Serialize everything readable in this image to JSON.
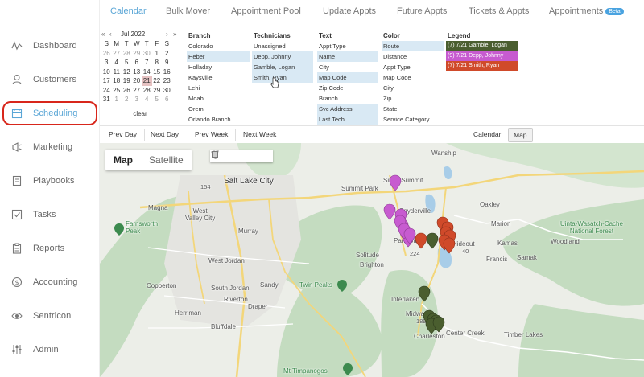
{
  "sidebar": {
    "items": [
      {
        "label": "Dashboard",
        "icon": "activity-icon"
      },
      {
        "label": "Customers",
        "icon": "user-icon"
      },
      {
        "label": "Scheduling",
        "icon": "calendar-icon"
      },
      {
        "label": "Marketing",
        "icon": "megaphone-icon"
      },
      {
        "label": "Playbooks",
        "icon": "book-icon"
      },
      {
        "label": "Tasks",
        "icon": "checkbox-icon"
      },
      {
        "label": "Reports",
        "icon": "clipboard-icon"
      },
      {
        "label": "Accounting",
        "icon": "dollar-icon"
      },
      {
        "label": "Sentricon",
        "icon": "eye-icon"
      },
      {
        "label": "Admin",
        "icon": "sliders-icon"
      }
    ],
    "active": "Scheduling",
    "highlight_color": "#d8261b",
    "accent": "#5aa6d6"
  },
  "topnav": {
    "tabs": [
      "Calendar",
      "Bulk Mover",
      "Appointment Pool",
      "Update Appts",
      "Future Appts",
      "Tickets & Appts",
      "Appointments"
    ],
    "active": "Calendar",
    "beta_badge": "Beta"
  },
  "calendar": {
    "prev": "«",
    "prev_month": "‹",
    "next_month": "›",
    "next": "»",
    "title": "Jul 2022",
    "weekdays": [
      "S",
      "M",
      "T",
      "W",
      "T",
      "F",
      "S"
    ],
    "weeks": [
      [
        "26",
        "27",
        "28",
        "29",
        "30",
        "1",
        "2"
      ],
      [
        "3",
        "4",
        "5",
        "6",
        "7",
        "8",
        "9"
      ],
      [
        "10",
        "11",
        "12",
        "13",
        "14",
        "15",
        "16"
      ],
      [
        "17",
        "18",
        "19",
        "20",
        "21",
        "22",
        "23"
      ],
      [
        "24",
        "25",
        "26",
        "27",
        "28",
        "29",
        "30"
      ],
      [
        "31",
        "1",
        "2",
        "3",
        "4",
        "5",
        "6"
      ]
    ],
    "selected_day": "21",
    "clear": "clear"
  },
  "filters": {
    "branch": {
      "header": "Branch",
      "items": [
        "Colorado",
        "Heber",
        "Holladay",
        "Kaysville",
        "Lehi",
        "Moab",
        "Orem",
        "Orlando Branch"
      ],
      "selected": [
        "Heber"
      ]
    },
    "technicians": {
      "header": "Technicians",
      "items": [
        "Unassigned",
        "Depp, Johnny",
        "Gamble, Logan",
        "Smith, Ryan"
      ],
      "selected": [
        "Depp, Johnny",
        "Gamble, Logan",
        "Smith, Ryan"
      ]
    },
    "text": {
      "header": "Text",
      "items": [
        "Appt Type",
        "Name",
        "City",
        "Map Code",
        "Zip Code",
        "Branch",
        "Svc Address",
        "Last Tech"
      ],
      "selected": [
        "Name",
        "Map Code",
        "Svc Address",
        "Last Tech"
      ]
    },
    "color": {
      "header": "Color",
      "items": [
        "Route",
        "Distance",
        "Appt Type",
        "Map Code",
        "City",
        "Zip",
        "State",
        "Service Category"
      ],
      "selected": [
        "Route"
      ]
    },
    "legend": {
      "header": "Legend",
      "items": [
        {
          "label": "(7) 7/21 Gamble, Logan",
          "color": "#4a5e2f"
        },
        {
          "label": "(9) 7/21 Depp, Johnny",
          "color": "#c75bd0"
        },
        {
          "label": "(7) 7/21 Smith, Ryan",
          "color": "#d04a2a"
        }
      ]
    }
  },
  "toolbar": {
    "prev_day": "Prev Day",
    "next_day": "Next Day",
    "prev_week": "Prev Week",
    "next_week": "Next Week",
    "calendar": "Calendar",
    "map": "Map"
  },
  "map": {
    "type_map": "Map",
    "type_satellite": "Satellite",
    "tools": [
      "hand-icon",
      "circle-icon",
      "polygon-icon",
      "rectangle-icon"
    ],
    "places": {
      "salt_lake_city": "Salt Lake City",
      "magna": "Magna",
      "west_valley_city": "West\nValley City",
      "murray": "Murray",
      "west_jordan": "West Jordan",
      "south_jordan": "South Jordan",
      "sandy": "Sandy",
      "copperton": "Copperton",
      "herriman": "Herriman",
      "bluffdale": "Bluffdale",
      "draper": "Draper",
      "riverton": "Riverton",
      "farnsworth_peak": "Farnsworth\nPeak",
      "twin_peaks": "Twin Peaks",
      "solitude": "Solitude",
      "brighton": "Brighton",
      "summit_park": "Summit Park",
      "silver_summit": "Silver Summit",
      "snyderville": "Snyderville",
      "park_city": "Park City",
      "hideout": "Hideout",
      "wanship": "Wanship",
      "oakley": "Oakley",
      "marion": "Marion",
      "kamas": "Kamas",
      "samak": "Samak",
      "francis": "Francis",
      "woodland": "Woodland",
      "uinta": "Uinta-Wasatch-Cache\nNational Forest",
      "interlaken": "Interlaken",
      "midway": "Midway",
      "charleston": "Charleston",
      "center_creek": "Center Creek",
      "timber_lakes": "Timber Lakes",
      "mt_timpanogos": "Mt Timpanogos",
      "highway_154": "154",
      "highway_224": "224",
      "highway_189": "189",
      "highway_40": "40"
    },
    "pins": {
      "purple": "#c75bd0",
      "green": "#4a5e2f",
      "orange": "#d04a2a"
    }
  }
}
